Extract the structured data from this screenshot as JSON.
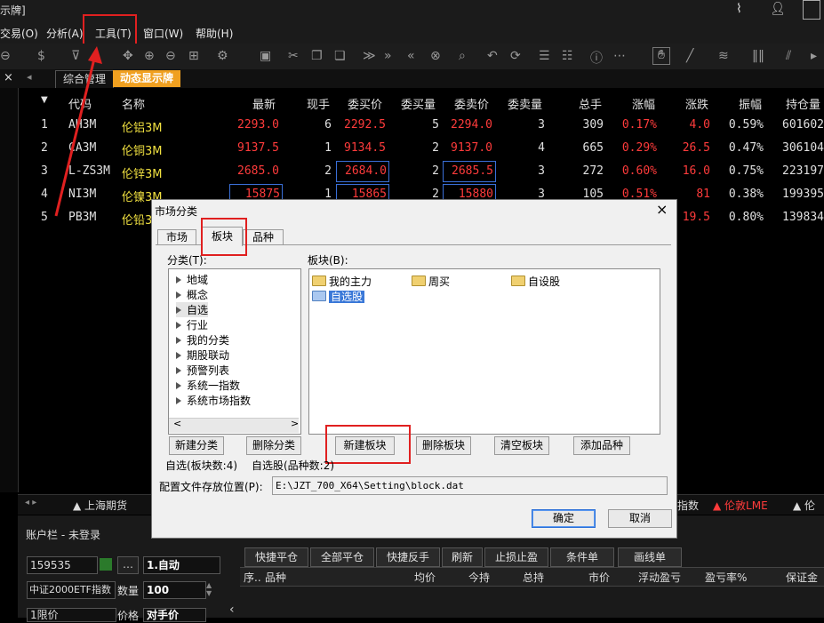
{
  "window": {
    "title": "示牌]"
  },
  "menu": [
    "交易(O)",
    "分析(A)",
    "工具(T)",
    "窗口(W)",
    "帮助(H)"
  ],
  "tabs": {
    "close": "×",
    "arrow": "◂",
    "items": [
      "综合管理",
      "动态显示牌"
    ]
  },
  "table": {
    "headers": [
      "代码",
      "名称",
      "最新",
      "现手",
      "委买价",
      "委买量",
      "委卖价",
      "委卖量",
      "总手",
      "涨幅",
      "涨跌",
      "振幅",
      "持仓量"
    ],
    "rows": [
      {
        "no": "1",
        "code": "AH3M",
        "name": "伦铝3M",
        "last": "2293.0",
        "vol": "6",
        "bid": "2292.5",
        "bidq": "5",
        "ask": "2294.0",
        "askq": "3",
        "total": "309",
        "chg_pct": "0.17%",
        "chg": "4.0",
        "amp": "0.59%",
        "oi": "601602"
      },
      {
        "no": "2",
        "code": "CA3M",
        "name": "伦铜3M",
        "last": "9137.5",
        "vol": "1",
        "bid": "9134.5",
        "bidq": "2",
        "ask": "9137.0",
        "askq": "4",
        "total": "665",
        "chg_pct": "0.29%",
        "chg": "26.5",
        "amp": "0.47%",
        "oi": "306104"
      },
      {
        "no": "3",
        "code": "L-ZS3M",
        "name": "伦锌3M",
        "last": "2685.0",
        "vol": "2",
        "bid": "2684.0",
        "bidq": "2",
        "ask": "2685.5",
        "askq": "3",
        "total": "272",
        "chg_pct": "0.60%",
        "chg": "16.0",
        "amp": "0.75%",
        "oi": "223197"
      },
      {
        "no": "4",
        "code": "NI3M",
        "name": "伦镍3M",
        "last": "15875",
        "vol": "1",
        "bid": "15865",
        "bidq": "2",
        "ask": "15880",
        "askq": "3",
        "total": "105",
        "chg_pct": "0.51%",
        "chg": "81",
        "amp": "0.38%",
        "oi": "199395"
      },
      {
        "no": "5",
        "code": "PB3M",
        "name": "伦铅3",
        "last": "",
        "vol": "",
        "bid": "",
        "bidq": "",
        "ask": "",
        "askq": "",
        "total": "",
        "chg_pct": "",
        "chg": "19.5",
        "amp": "0.80%",
        "oi": "139834"
      }
    ]
  },
  "market_tabs": {
    "left": "▲ 上海期货",
    "right1": "指数",
    "right2": "▲ 伦敦LME",
    "right3": "▲ 伦"
  },
  "account": {
    "title": "账户栏 - 未登录",
    "account_no": "159535",
    "mode": "1.自动",
    "instrument": "中证2000ETF指数",
    "qty_label": "数量",
    "qty": "100",
    "price_type": "1限价",
    "price_label": "价格",
    "price_value": "对手价",
    "buttons": [
      "快捷平仓",
      "全部平仓",
      "快捷反手",
      "刷新",
      "止损止盈",
      "条件单",
      "画线单"
    ],
    "columns": [
      "序..",
      "品种",
      "均价",
      "今持",
      "总持",
      "市价",
      "浮动盈亏",
      "盈亏率%",
      "保证金"
    ]
  },
  "dialog": {
    "title": "市场分类",
    "close": "×",
    "tabs": [
      "市场",
      "板块",
      "品种"
    ],
    "category_label": "分类(T):",
    "categories": [
      "地域",
      "概念",
      "自选",
      "行业",
      "我的分类",
      "期股联动",
      "预警列表",
      "系统一指数",
      "系统市场指数"
    ],
    "block_label": "板块(B):",
    "blocks": [
      "我的主力",
      "周买",
      "自设股",
      "自选股"
    ],
    "btn_new_category": "新建分类",
    "btn_delete_category": "删除分类",
    "btn_new_block": "新建板块",
    "btn_delete_block": "删除板块",
    "btn_clear_block": "清空板块",
    "btn_add_item": "添加品种",
    "status_left": "自选(板块数:4)",
    "status_right": "自选股(品种数:2)",
    "path_label": "配置文件存放位置(P):",
    "path_value": "E:\\JZT_700_X64\\Setting\\block.dat",
    "ok": "确定",
    "cancel": "取消"
  },
  "colors": {
    "accent_red": "#e02020",
    "price_red": "#ff3b3b",
    "name_yellow": "#f0e040",
    "tab_active": "#f0a020"
  }
}
